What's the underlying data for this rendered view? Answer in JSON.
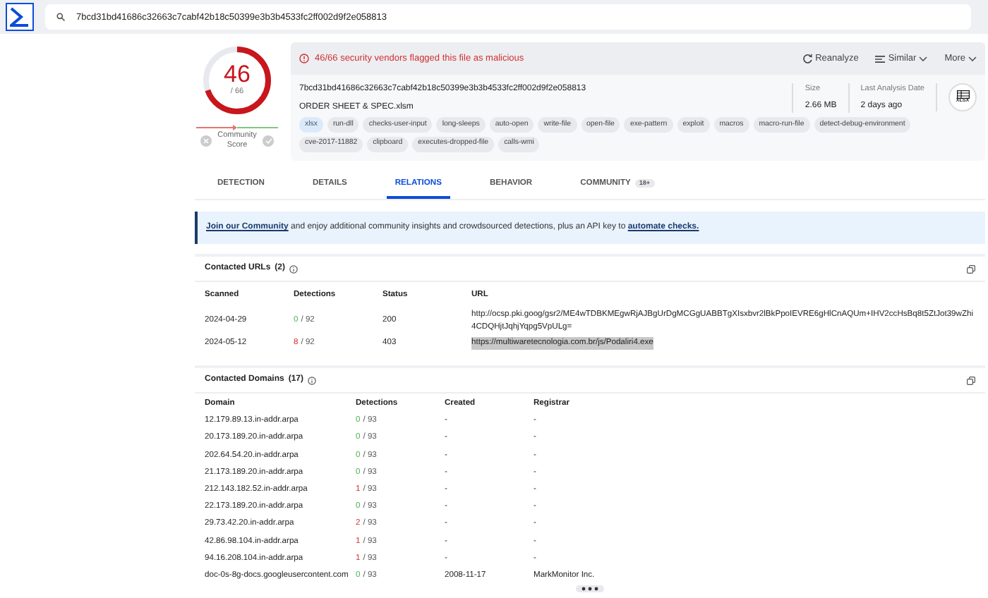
{
  "search": {
    "value": "7bcd31bd41686c32663c7cabf42b18c50399e3b3b4533fc2ff002d9f2e058813"
  },
  "score": {
    "detected": "46",
    "total": "/ 66",
    "level": 0.697,
    "community_label": "Community Score"
  },
  "alert": {
    "text": "46/66 security vendors flagged this file as malicious"
  },
  "actions": [
    {
      "label": "Reanalyze",
      "kind": "reanalyze"
    },
    {
      "label": "Similar",
      "kind": "similar"
    },
    {
      "label": "More",
      "kind": "more"
    }
  ],
  "file": {
    "hash": "7bcd31bd41686c32663c7cabf42b18c50399e3b3b4533fc2ff002d9f2e058813",
    "name": "ORDER SHEET & SPEC.xlsm",
    "size_label": "Size",
    "size": "2.66 MB",
    "date_label": "Last Analysis Date",
    "date": "2 days ago",
    "type_icon": "XLSX"
  },
  "tags": [
    {
      "label": "xlsx",
      "kind": "filetype"
    },
    {
      "label": "run-dll",
      "kind": "tag"
    },
    {
      "label": "checks-user-input",
      "kind": "tag"
    },
    {
      "label": "long-sleeps",
      "kind": "tag"
    },
    {
      "label": "auto-open",
      "kind": "tag"
    },
    {
      "label": "write-file",
      "kind": "tag"
    },
    {
      "label": "open-file",
      "kind": "tag"
    },
    {
      "label": "exe-pattern",
      "kind": "tag"
    },
    {
      "label": "exploit",
      "kind": "tag"
    },
    {
      "label": "macros",
      "kind": "tag"
    },
    {
      "label": "macro-run-file",
      "kind": "tag"
    },
    {
      "label": "detect-debug-environment",
      "kind": "tag"
    },
    {
      "label": "cve-2017-11882",
      "kind": "tag"
    },
    {
      "label": "clipboard",
      "kind": "tag"
    },
    {
      "label": "executes-dropped-file",
      "kind": "tag"
    },
    {
      "label": "calls-wmi",
      "kind": "tag"
    }
  ],
  "tabs": [
    {
      "label": "DETECTION",
      "selected": false
    },
    {
      "label": "DETAILS",
      "selected": false
    },
    {
      "label": "RELATIONS",
      "selected": true
    },
    {
      "label": "BEHAVIOR",
      "selected": false
    },
    {
      "label": "COMMUNITY",
      "selected": false,
      "badge": "18+"
    }
  ],
  "banner": {
    "link1": "Join our Community",
    "text": "and enjoy additional community insights and crowdsourced detections, plus an API key to",
    "link2": "automate checks."
  },
  "urls": {
    "title": "Contacted URLs",
    "count": "(2)",
    "columns": [
      "Scanned",
      "Detections",
      "Status",
      "URL"
    ],
    "rows": [
      {
        "scanned": "2024-04-29",
        "detections": "0",
        "malicious": false,
        "total": "/ 92",
        "status": "200",
        "url": "http://ocsp.pki.goog/gsr2/ME4wTDBKMEgwRjAJBgUrDgMCGgUABBTgXIsxbvr2lBkPpoIEVRE6gHlCnAQUm+IHV2ccHsBq8t5ZtJot39wZhi4CDQHjtJqhjYqpg5VpULg=",
        "highlighted": false
      },
      {
        "scanned": "2024-05-12",
        "detections": "8",
        "malicious": true,
        "total": "/ 92",
        "status": "403",
        "url": "https://multiwaretecnologia.com.br/js/Podaliri4.exe",
        "highlighted": true
      }
    ]
  },
  "domains": {
    "title": "Contacted Domains",
    "count": "(17)",
    "columns": [
      "Domain",
      "Detections",
      "Created",
      "Registrar"
    ],
    "rows": [
      {
        "domain": "12.179.89.13.in-addr.arpa",
        "detections": "0",
        "malicious": false,
        "total": "/ 93",
        "created": "-",
        "registrar": "-"
      },
      {
        "domain": "20.173.189.20.in-addr.arpa",
        "detections": "0",
        "malicious": false,
        "total": "/ 93",
        "created": "-",
        "registrar": "-"
      },
      {
        "domain": "202.64.54.20.in-addr.arpa",
        "detections": "0",
        "malicious": false,
        "total": "/ 93",
        "created": "-",
        "registrar": "-"
      },
      {
        "domain": "21.173.189.20.in-addr.arpa",
        "detections": "0",
        "malicious": false,
        "total": "/ 93",
        "created": "-",
        "registrar": "-"
      },
      {
        "domain": "212.143.182.52.in-addr.arpa",
        "detections": "1",
        "malicious": true,
        "total": "/ 93",
        "created": "-",
        "registrar": "-"
      },
      {
        "domain": "22.173.189.20.in-addr.arpa",
        "detections": "0",
        "malicious": false,
        "total": "/ 93",
        "created": "-",
        "registrar": "-"
      },
      {
        "domain": "29.73.42.20.in-addr.arpa",
        "detections": "2",
        "malicious": true,
        "total": "/ 93",
        "created": "-",
        "registrar": "-"
      },
      {
        "domain": "42.86.98.104.in-addr.arpa",
        "detections": "1",
        "malicious": true,
        "total": "/ 93",
        "created": "-",
        "registrar": "-"
      },
      {
        "domain": "94.16.208.104.in-addr.arpa",
        "detections": "1",
        "malicious": true,
        "total": "/ 93",
        "created": "-",
        "registrar": "-"
      },
      {
        "domain": "doc-0s-8g-docs.googleusercontent.com",
        "detections": "0",
        "malicious": false,
        "total": "/ 93",
        "created": "2008-11-17",
        "registrar": "MarkMonitor Inc."
      }
    ]
  }
}
